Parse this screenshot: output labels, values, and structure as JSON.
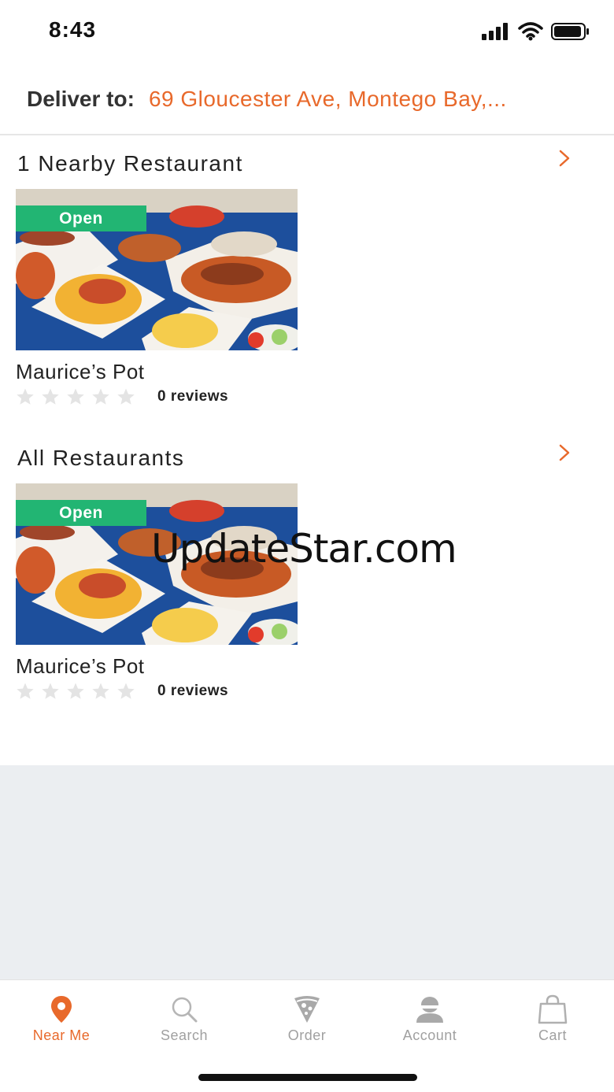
{
  "status_bar": {
    "time": "8:43"
  },
  "delivery": {
    "label": "Deliver to:",
    "address": "69 Gloucester Ave, Montego Bay,..."
  },
  "sections": [
    {
      "title": "1 Nearby Restaurant",
      "card": {
        "badge": "Open",
        "name": "Maurice’s Pot",
        "rating": 0,
        "reviews": "0 reviews"
      }
    },
    {
      "title": "All Restaurants",
      "card": {
        "badge": "Open",
        "name": "Maurice’s Pot",
        "rating": 0,
        "reviews": "0 reviews"
      }
    }
  ],
  "watermark": "UpdateStar.com",
  "tabs": [
    {
      "label": "Near Me",
      "icon": "location-pin-icon",
      "active": true
    },
    {
      "label": "Search",
      "icon": "search-icon",
      "active": false
    },
    {
      "label": "Order",
      "icon": "pizza-icon",
      "active": false
    },
    {
      "label": "Account",
      "icon": "account-icon",
      "active": false
    },
    {
      "label": "Cart",
      "icon": "shopping-bag-icon",
      "active": false
    }
  ],
  "colors": {
    "accent": "#e8692b",
    "open_badge": "#22b573",
    "inactive_tab": "#a0a0a0",
    "empty_area": "#ebeef1"
  }
}
